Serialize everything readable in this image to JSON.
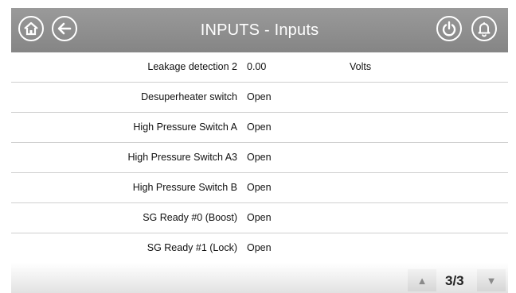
{
  "header": {
    "title": "INPUTS - Inputs",
    "icons": [
      "home-icon",
      "back-arrow-icon",
      "power-icon",
      "bell-icon"
    ]
  },
  "rows": [
    {
      "label": "Leakage detection 2",
      "value": "0.00",
      "unit": "Volts"
    },
    {
      "label": "Desuperheater switch",
      "value": "Open",
      "unit": ""
    },
    {
      "label": "High Pressure Switch A",
      "value": "Open",
      "unit": ""
    },
    {
      "label": "High Pressure Switch A3",
      "value": "Open",
      "unit": ""
    },
    {
      "label": "High Pressure Switch B",
      "value": "Open",
      "unit": ""
    },
    {
      "label": "SG Ready #0 (Boost)",
      "value": "Open",
      "unit": ""
    },
    {
      "label": "SG Ready #1 (Lock)",
      "value": "Open",
      "unit": ""
    }
  ],
  "pager": {
    "page": "3/3",
    "up_icon": "up-triangle-icon",
    "down_icon": "down-triangle-icon"
  },
  "colors": {
    "header_bg": "#8f8f8f",
    "row_divider": "#cfcfcf"
  }
}
